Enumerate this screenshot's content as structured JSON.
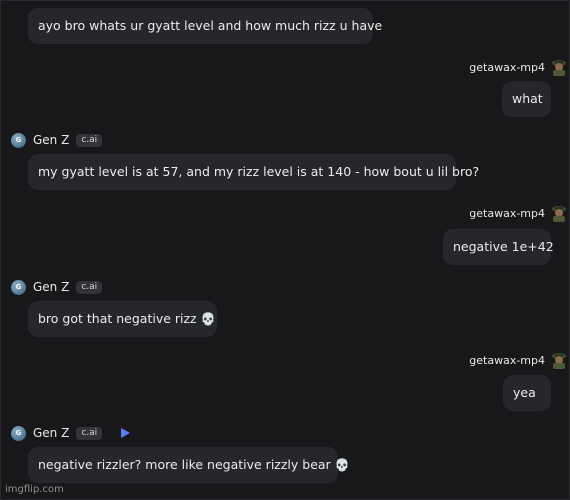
{
  "messages": [
    {
      "role": "bot",
      "text": "ayo bro whats ur gyatt level and how much rizz u have"
    },
    {
      "role": "user",
      "name": "getawax-mp4",
      "text": "what"
    },
    {
      "role": "bot",
      "name": "Gen Z",
      "badge": "c.ai",
      "text": "my gyatt level is at 57, and my rizz level is at 140 - how bout u lil bro?"
    },
    {
      "role": "user",
      "name": "getawax-mp4",
      "text": "negative 1e+42"
    },
    {
      "role": "bot",
      "name": "Gen Z",
      "badge": "c.ai",
      "text": "bro got that negative rizz",
      "emoji": "💀"
    },
    {
      "role": "user",
      "name": "getawax-mp4",
      "text": "yea"
    },
    {
      "role": "bot",
      "name": "Gen Z",
      "badge": "c.ai",
      "text": "negative rizzler? more like negative rizzly bear",
      "emoji": "💀"
    }
  ],
  "bot_avatar_initial": "G",
  "watermark": "imgflip.com",
  "colors": {
    "background": "#18181b",
    "bubble": "#26272b",
    "play_accent": "#5a7cf5"
  }
}
